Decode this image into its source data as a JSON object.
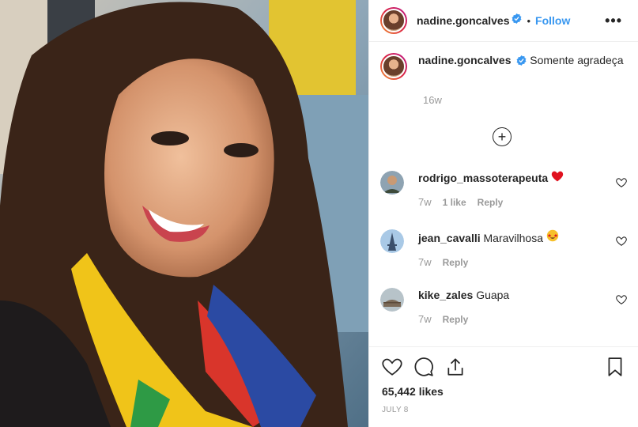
{
  "post": {
    "username": "nadine.goncalves",
    "follow_label": "Follow",
    "more_label": "•••",
    "caption_text": "Somente agradeça",
    "caption_age": "16w",
    "likes": "65,442 likes",
    "date": "July 8"
  },
  "comments": [
    {
      "user": "rodrigo_massoterapeuta",
      "text": "",
      "emoji": "heart",
      "age": "7w",
      "likes": "1 like",
      "reply": "Reply"
    },
    {
      "user": "jean_cavalli",
      "text": "Maravilhosa",
      "emoji": "star-eyes",
      "age": "7w",
      "likes": "",
      "reply": "Reply"
    },
    {
      "user": "kike_zales",
      "text": "Guapa",
      "emoji": "",
      "age": "7w",
      "likes": "",
      "reply": "Reply"
    }
  ],
  "colors": {
    "link": "#3897f0",
    "muted": "#999999",
    "verified": "#3897f0",
    "heart": "#ed4956"
  },
  "icons": [
    "verified-badge-icon",
    "more-icon",
    "add-circle-icon",
    "heart-outline-icon",
    "comment-icon",
    "share-icon",
    "bookmark-icon"
  ]
}
